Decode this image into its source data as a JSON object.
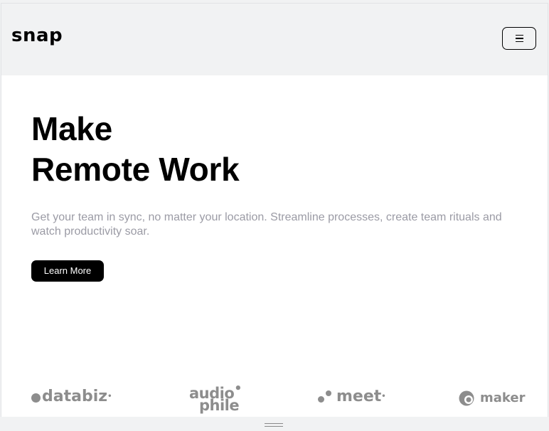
{
  "header": {
    "logo": "snap",
    "menu_icon": "hamburger-menu-icon"
  },
  "hero": {
    "headline_line1": "Make",
    "headline_line2": "Remote Work",
    "description": "Get your team in sync, no matter your location. Streamline processes, create team rituals and watch productivity soar.",
    "cta_label": "Learn More"
  },
  "partners": {
    "databiz": "databiz",
    "audiophile_line1": "audio",
    "audiophile_line2": "phile",
    "meet": "meet",
    "maker": "maker"
  },
  "colors": {
    "background": "#f1f2f3",
    "text_primary": "#000000",
    "text_muted": "#9b9ba5",
    "logo_gray": "#8d8d8d",
    "button_bg": "#000000",
    "button_text": "#ffffff"
  }
}
